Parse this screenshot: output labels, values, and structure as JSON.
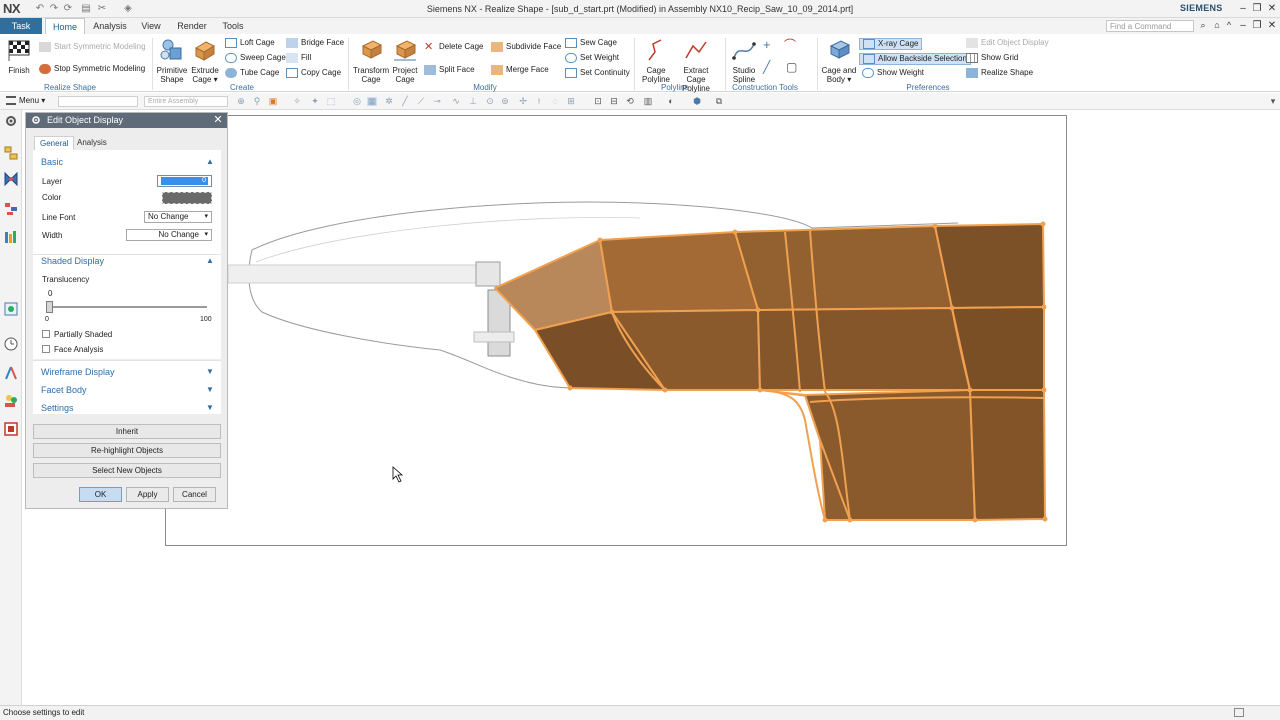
{
  "app": {
    "logo": "NX",
    "window_title": "Siemens NX - Realize Shape - [sub_d_start.prt (Modified)  in Assembly NX10_Recip_Saw_10_09_2014.prt]",
    "brand": "SIEMENS",
    "search_placeholder": "Find a Command"
  },
  "tabs": [
    "Task",
    "Home",
    "Analysis",
    "View",
    "Render",
    "Tools"
  ],
  "ribbon": {
    "finish": "Finish",
    "start_symmetric": "Start Symmetric Modeling",
    "stop_symmetric": "Stop Symmetric Modeling",
    "primitive_shape": [
      "Primitive",
      "Shape"
    ],
    "extrude_cage": [
      "Extrude",
      "Cage ▾"
    ],
    "loft_cage": "Loft Cage",
    "sweep_cage": "Sweep Cage",
    "tube_cage": "Tube Cage",
    "bridge_face": "Bridge Face",
    "fill": "Fill",
    "copy_cage": "Copy Cage",
    "transform_cage": [
      "Transform",
      "Cage"
    ],
    "project_cage": [
      "Project",
      "Cage"
    ],
    "delete_cage": "Delete Cage",
    "split_face": "Split Face",
    "subdivide_face": "Subdivide Face",
    "merge_face": "Merge Face",
    "sew_cage": "Sew Cage",
    "set_weight": "Set Weight",
    "set_continuity": "Set Continuity",
    "cage_polyline": [
      "Cage",
      "Polyline"
    ],
    "extract_cage_polyline": [
      "Extract Cage",
      "Polyline"
    ],
    "studio_spline": [
      "Studio",
      "Spline"
    ],
    "cage_and_body": [
      "Cage and",
      "Body ▾"
    ],
    "xray_cage": "X-ray Cage",
    "allow_backside": "Allow Backside Selection",
    "show_weight": "Show Weight",
    "edit_object_display": "Edit Object Display",
    "show_grid": "Show Grid",
    "realize_shape": "Realize Shape",
    "groups": {
      "realize_shape": "Realize Shape",
      "create": "Create",
      "modify": "Modify",
      "polyline": "Polyline",
      "construction_tools": "Construction Tools",
      "preferences": "Preferences"
    }
  },
  "selbar": {
    "menu": "Menu ▾",
    "filter_placeholder": "",
    "scope": "Entire Assembly"
  },
  "dialog": {
    "title": "Edit Object Display",
    "tabs": [
      "General",
      "Analysis"
    ],
    "basic": "Basic",
    "layer_label": "Layer",
    "layer_value": "0",
    "color_label": "Color",
    "line_font_label": "Line Font",
    "line_font_value": "No Change",
    "width_label": "Width",
    "width_value": "No Change",
    "shaded_display": "Shaded Display",
    "translucency_label": "Translucency",
    "translucency_value": "0",
    "translucency_value_frac": 0,
    "slider_min": "0",
    "slider_max": "100",
    "partially_shaded": "Partially Shaded",
    "face_analysis": "Face Analysis",
    "wireframe_display": "Wireframe Display",
    "facet_body": "Facet Body",
    "settings": "Settings",
    "inherit": "Inherit",
    "rehighlight": "Re-highlight Objects",
    "select_new": "Select New Objects",
    "ok": "OK",
    "apply": "Apply",
    "cancel": "Cancel"
  },
  "status": {
    "text": "Choose settings to edit"
  },
  "colors": {
    "accent": "#2f6f9f",
    "cage_orange": "#f0a150",
    "body_brown": "#8a5a2c"
  }
}
